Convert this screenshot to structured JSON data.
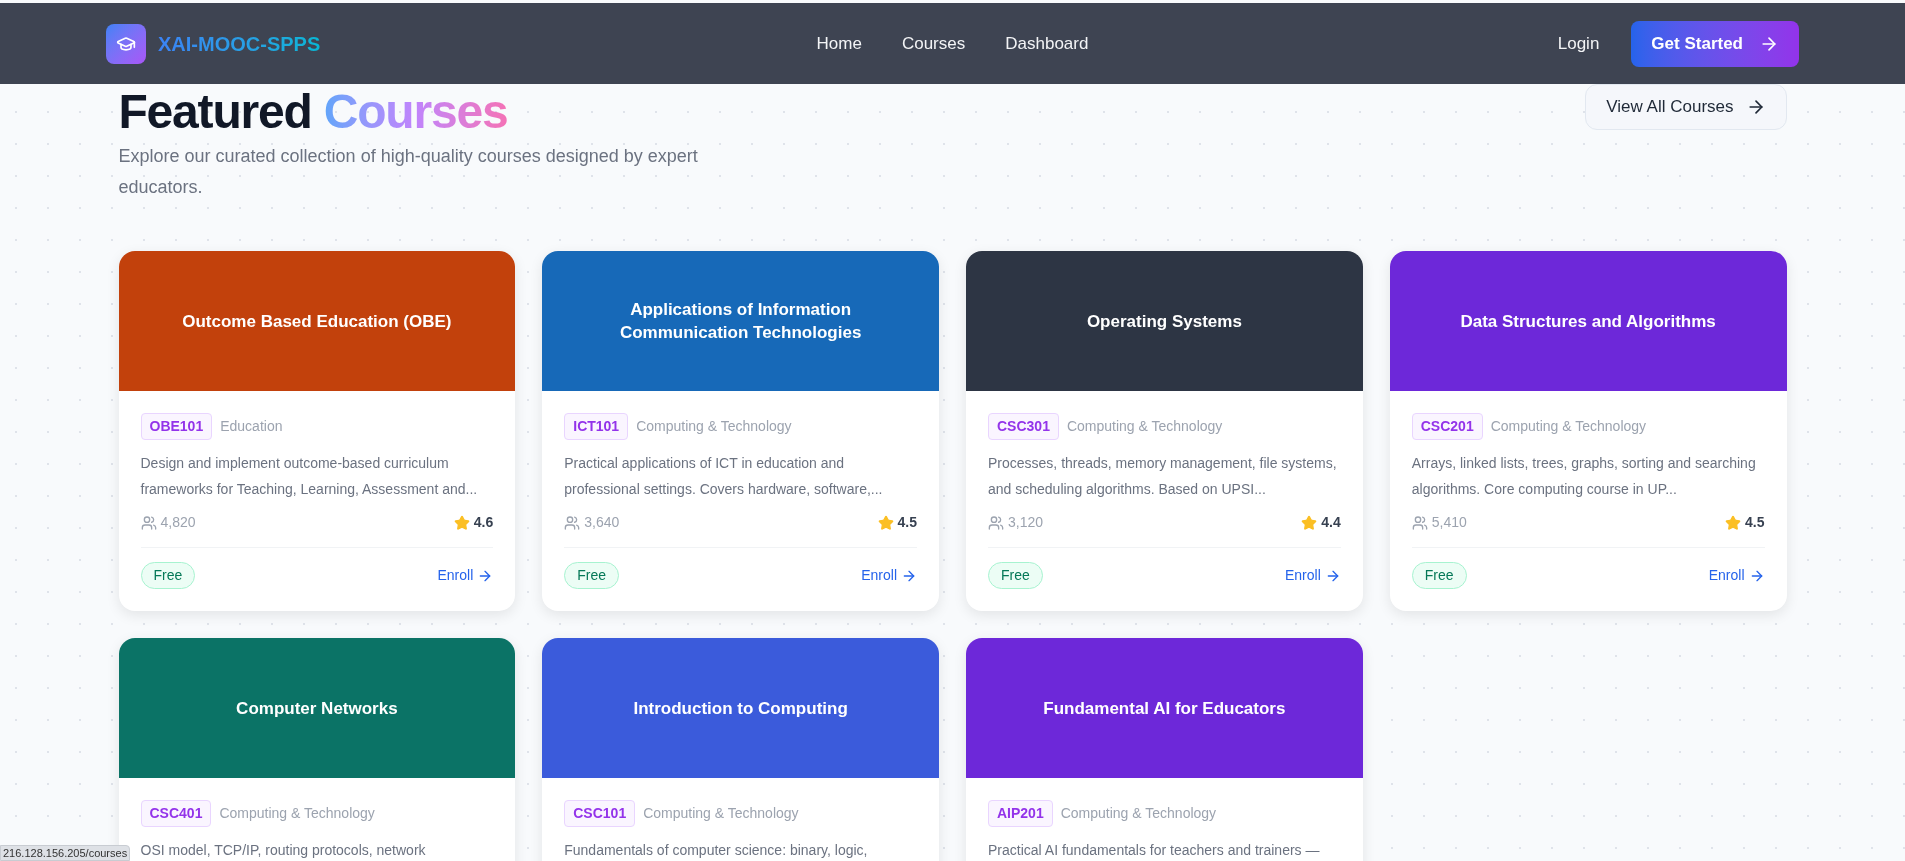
{
  "header": {
    "logo_text": "XAI-MOOC-SPPS",
    "nav": [
      {
        "label": "Home"
      },
      {
        "label": "Courses"
      },
      {
        "label": "Dashboard"
      }
    ],
    "login": "Login",
    "cta": "Get Started"
  },
  "section": {
    "title": "Featured",
    "title_accent": "Courses",
    "subtitle": "Explore our curated collection of high-quality courses designed by expert educators.",
    "view_all": "View All Courses"
  },
  "cards": [
    {
      "title": "Outcome Based Education (OBE)",
      "color": "#c2410c",
      "code": "OBE101",
      "category": "Education",
      "description": "Design and implement outcome-based curriculum frameworks for Teaching, Learning, Assessment and...",
      "students": "4,820",
      "rating": "4.6",
      "price": "Free",
      "action": "Enroll"
    },
    {
      "title": "Applications of Information Communication Technologies",
      "color": "#1769b8",
      "code": "ICT101",
      "category": "Computing & Technology",
      "description": "Practical applications of ICT in education and professional settings. Covers hardware, software,...",
      "students": "3,640",
      "rating": "4.5",
      "price": "Free",
      "action": "Enroll"
    },
    {
      "title": "Operating Systems",
      "color": "#2d3544",
      "code": "CSC301",
      "category": "Computing & Technology",
      "description": "Processes, threads, memory management, file systems, and scheduling algorithms. Based on UPSI...",
      "students": "3,120",
      "rating": "4.4",
      "price": "Free",
      "action": "Enroll"
    },
    {
      "title": "Data Structures and Algorithms",
      "color": "#6d28d9",
      "code": "CSC201",
      "category": "Computing & Technology",
      "description": "Arrays, linked lists, trees, graphs, sorting and searching algorithms. Core computing course in UP...",
      "students": "5,410",
      "rating": "4.5",
      "price": "Free",
      "action": "Enroll"
    },
    {
      "title": "Computer Networks",
      "color": "#0b7366",
      "code": "CSC401",
      "category": "Computing & Technology",
      "description": "OSI model, TCP/IP, routing protocols, network"
    },
    {
      "title": "Introduction to Computing",
      "color": "#3b5bdb",
      "code": "CSC101",
      "category": "Computing & Technology",
      "description": "Fundamentals of computer science: binary, logic,"
    },
    {
      "title": "Fundamental AI for Educators",
      "color": "#6d28d9",
      "code": "AIP201",
      "category": "Computing & Technology",
      "description": "Practical AI fundamentals for teachers and trainers —"
    }
  ],
  "status_bar": {
    "url": "216.128.156.205/courses"
  }
}
